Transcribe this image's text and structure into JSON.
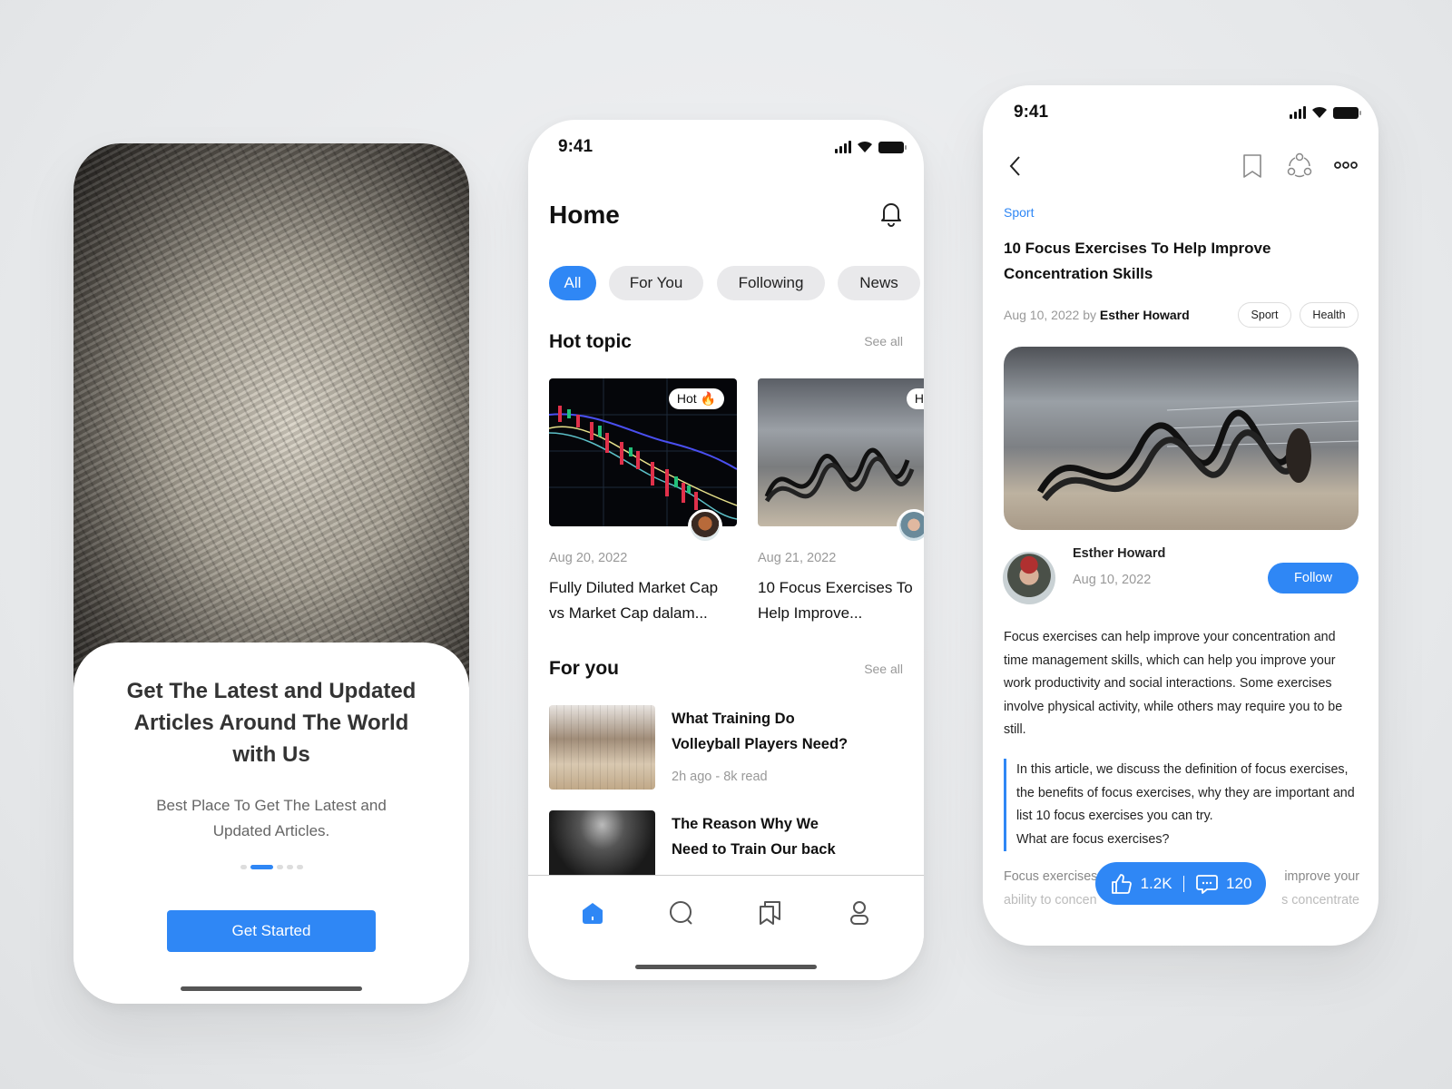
{
  "colors": {
    "accent": "#2f87f5",
    "background": "#e8eaec",
    "text": "#111111",
    "muted": "#999999"
  },
  "onboarding": {
    "title": "Get The Latest and Updated Articles Around The World with Us",
    "subtitle": "Best Place To Get The Latest and Updated Articles.",
    "pager": {
      "count": 5,
      "active": 1
    },
    "cta": "Get Started"
  },
  "home": {
    "status_time": "9:41",
    "title": "Home",
    "icons": {
      "notification": "bell-icon"
    },
    "tabs": [
      {
        "label": "All",
        "active": true
      },
      {
        "label": "For You"
      },
      {
        "label": "Following"
      },
      {
        "label": "News"
      }
    ],
    "hot_topic": {
      "heading": "Hot topic",
      "see_all": "See all",
      "cards": [
        {
          "badge": "Hot 🔥",
          "date": "Aug 20, 2022",
          "title_line1": "Fully Diluted Market Cap",
          "title_line2": "vs Market Cap dalam..."
        },
        {
          "badge": "Hot 🔥",
          "date": "Aug 21, 2022",
          "title_line1": "10 Focus Exercises To",
          "title_line2": "Help Improve..."
        }
      ]
    },
    "for_you": {
      "heading": "For you",
      "see_all": "See all",
      "items": [
        {
          "title_line1": "What Training Do",
          "title_line2": "Volleyball Players Need?",
          "meta": "2h ago - 8k read"
        },
        {
          "title_line1": "The Reason Why We",
          "title_line2": "Need to Train Our back"
        }
      ]
    },
    "nav": [
      {
        "icon": "home-icon",
        "active": true
      },
      {
        "icon": "search-icon"
      },
      {
        "icon": "bookmarks-icon"
      },
      {
        "icon": "profile-icon"
      }
    ]
  },
  "article": {
    "status_time": "9:41",
    "category": "Sport",
    "title_line1": "10 Focus Exercises To Help Improve",
    "title_line2": "Concentration Skills",
    "date": "Aug 10, 2022",
    "by": "by",
    "author": "Esther Howard",
    "tags": [
      "Sport",
      "Health"
    ],
    "author_card": {
      "name": "Esther Howard",
      "date": "Aug 10, 2022",
      "follow": "Follow"
    },
    "body": "Focus exercises can help improve your concentration and time management skills, which can help you improve your work productivity and social interactions. Some exercises involve physical activity, while others may require you to be still.",
    "quote": "In this article, we discuss the definition of focus exercises, the benefits of focus exercises, why they are important and list 10 focus exercises you can try.",
    "quote_question": "What are focus exercises?",
    "faded_line1_left": "Focus exercises",
    "faded_line1_right": "improve your",
    "faded_line2_left": "ability to concen",
    "faded_line2_right": "s concentrate",
    "likes": "1.2K",
    "comments": "120"
  }
}
